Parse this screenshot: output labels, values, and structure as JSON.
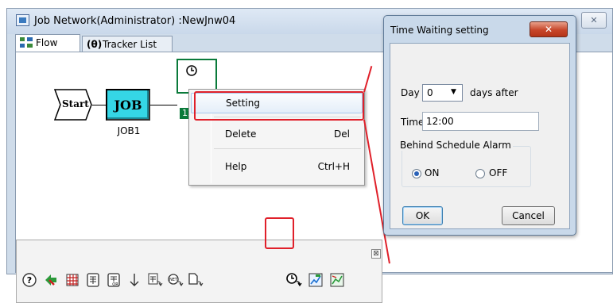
{
  "main_window": {
    "title": "Job Network(Administrator) :NewJnw04",
    "close_glyph": "✕",
    "tabs": [
      {
        "label": "Flow",
        "icon": "flow-icon"
      },
      {
        "label": "Tracker List",
        "icon": "tracker-icon"
      }
    ]
  },
  "flow": {
    "start_label": "Start",
    "job_text": "JOB",
    "job_label": "JOB1",
    "timer_time": "12:0"
  },
  "context_menu": {
    "items": [
      {
        "label": "Setting",
        "shortcut": ""
      },
      {
        "label": "Delete",
        "shortcut": "Del"
      },
      {
        "label": "Help",
        "shortcut": "Ctrl+H"
      }
    ]
  },
  "toolbar": {
    "close_glyph": "⊠",
    "icons": [
      "help-icon",
      "arrow-connect-icon",
      "grid-icon",
      "table-icon",
      "table-or-icon",
      "down-arrow-icon",
      "branch-icon",
      "job-net-icon",
      "document-icon",
      "time-wait-icon",
      "chart-edit-icon",
      "chart-view-icon"
    ]
  },
  "dialog": {
    "title": "Time Waiting setting",
    "close_glyph": "✕",
    "day_label": "Day",
    "day_value": "0",
    "days_after_label": "days after",
    "time_label": "Time",
    "time_value": "12:00",
    "alarm_group_title": "Behind Schedule Alarm",
    "radio_on_label": "ON",
    "radio_off_label": "OFF",
    "alarm_selected": "ON",
    "ok_label": "OK",
    "cancel_label": "Cancel"
  },
  "colors": {
    "highlight_red": "#e0202a",
    "job_box": "#35d6e6",
    "timer_green": "#0a7a3a"
  }
}
